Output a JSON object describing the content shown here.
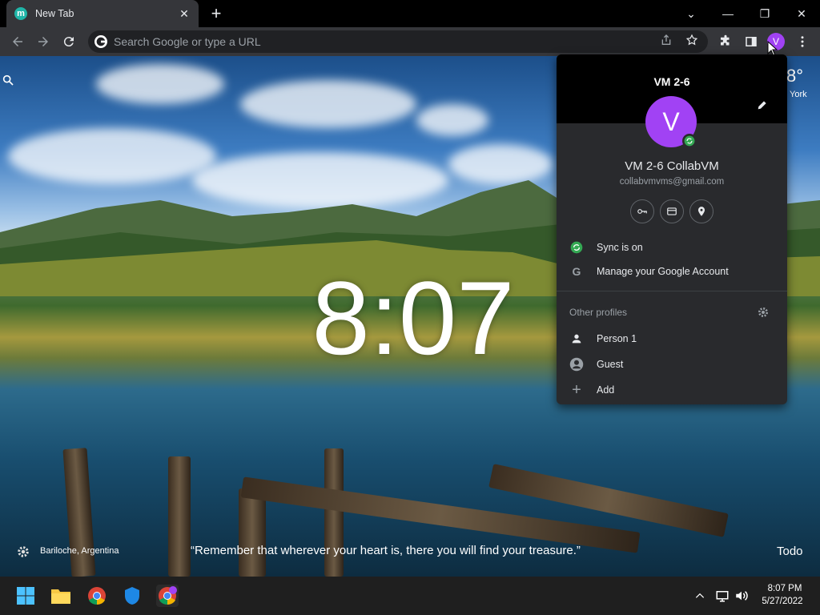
{
  "tab": {
    "title": "New Tab",
    "favicon_letter": "m"
  },
  "window_controls": {
    "dropdown": "⌄",
    "minimize": "—",
    "restore": "❐",
    "close": "✕"
  },
  "toolbar": {
    "omnibox_placeholder": "Search Google or type a URL",
    "avatar_letter": "V"
  },
  "wallpaper": {
    "clock": "8:07",
    "weather_temp": "8°",
    "weather_city": "York",
    "location": "Bariloche, Argentina",
    "quote": "“Remember that wherever your heart is, there you will find your treasure.”",
    "todo": "Todo"
  },
  "profile_menu": {
    "header_name": "VM 2-6",
    "avatar_letter": "V",
    "full_name": "VM 2-6 CollabVM",
    "email": "collabvmvms@gmail.com",
    "sync": "Sync is on",
    "manage_account": "Manage your Google Account",
    "other_profiles_label": "Other profiles",
    "profiles": [
      {
        "label": "Person 1"
      },
      {
        "label": "Guest"
      },
      {
        "label": "Add"
      }
    ]
  },
  "taskbar": {
    "time": "8:07 PM",
    "date": "5/27/2022"
  },
  "colors": {
    "accent_avatar": "#a142f4",
    "sync_green": "#34a853"
  }
}
